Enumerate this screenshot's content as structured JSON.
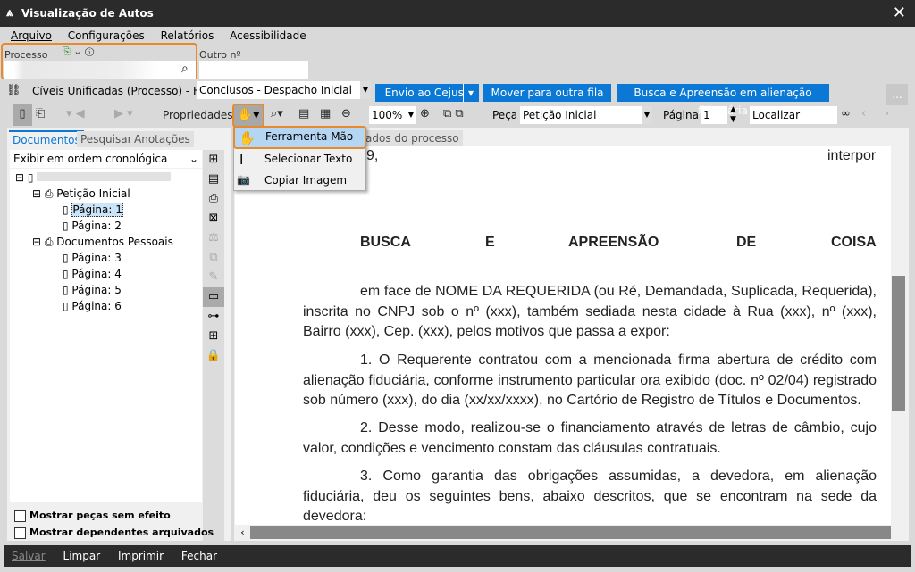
{
  "window": {
    "title": "Visualização de Autos",
    "close": "✕"
  },
  "menu": [
    "Arquivo",
    "Configurações",
    "Relatórios",
    "Acessibilidade"
  ],
  "processo": {
    "label": "Processo",
    "other_label": "Outro nº",
    "value": "",
    "other_value": ""
  },
  "queue": {
    "label": "Cíveis Unificadas (Processo) - Fila:",
    "fila": "Conclusos - Despacho Inicial",
    "buttons": [
      "Envio ao Cejusc",
      "Mover para outra fila",
      "Busca e Apreensão em alienação fiduciária"
    ],
    "more": "..."
  },
  "toolbar": {
    "propriedades": "Propriedades",
    "zoom": "100%",
    "peca_label": "Peça",
    "peca": "Petição Inicial",
    "pagina_label": "Página",
    "pagina": "1",
    "localizar": "Localizar"
  },
  "hand_menu": {
    "items": [
      "Ferramenta Mão",
      "Selecionar Texto",
      "Copiar Imagem"
    ]
  },
  "hidden_tab": "ados do processo",
  "left": {
    "tabs": [
      "Documentos",
      "Pesquisar",
      "Anotações"
    ],
    "order": "Exibir em ordem cronológica",
    "tree": [
      {
        "label": "Petição Inicial",
        "pages": [
          "Página: 1",
          "Página: 2"
        ]
      },
      {
        "label": "Documentos Pessoais",
        "pages": [
          "Página: 3",
          "Página: 4",
          "Página: 5",
          "Página: 6"
        ]
      }
    ],
    "checkboxes": [
      "Mostrar peças sem efeito",
      "Mostrar dependentes arquivados"
    ]
  },
  "document": {
    "top_left": "9,",
    "top_right": "interpor",
    "heading": [
      "BUSCA",
      "E",
      "APREENSÃO",
      "DE",
      "COISA"
    ],
    "paragraphs": [
      "em face de NOME DA REQUERIDA (ou Ré, Demandada, Suplicada, Requerida), inscrita no CNPJ sob o nº (xxx), também sediada nesta cidade à Rua (xxx), nº (xxx), Bairro (xxx), Cep. (xxx), pelos motivos que passa a expor:",
      "1. O Requerente contratou com a mencionada firma abertura de crédito com alienação fiduciária, conforme instrumento particular ora exibido (doc. nº 02/04) registrado sob número (xxx), do dia (xx/xx/xxxx), no Cartório de Registro de Títulos e Documentos.",
      "2. Desse modo, realizou-se o financiamento através de letras de câmbio, cujo valor, condições e vencimento constam das cláusulas contratuais.",
      "3. Como garantia das obrigações assumidas, a devedora, em alienação fiduciária, deu os seguintes bens, abaixo descritos, que se encontram na sede da devedora:"
    ]
  },
  "footer": [
    "Salvar",
    "Limpar",
    "Imprimir",
    "Fechar"
  ],
  "colors": {
    "accent": "#0a78d4",
    "highlight": "#e8892b"
  }
}
